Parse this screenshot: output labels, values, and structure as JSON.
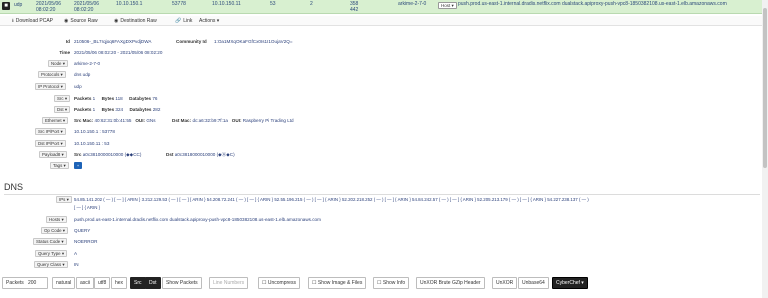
{
  "session": {
    "protocol": "udp",
    "start_time": "2021/05/06 08:02:20",
    "stop_time": "2021/05/06 08:02:20",
    "src_ip": "10.10.150.1",
    "src_port": "53778",
    "dst_ip": "10.10.150.11",
    "dst_port": "53",
    "packets": "2",
    "bytes": "358",
    "databytes": "442",
    "node": "arkime-2-7-0",
    "host_label": "Host",
    "hosts_text": "push.prod.us-east-1.internal.dradis.netflix.com   dualstack.apiproxy-push-vpc8-1850382108.us-east-1.elb.amazonaws.com"
  },
  "toolbar": {
    "download_pcap": "Download PCAP",
    "source_raw": "Source Raw",
    "destination_raw": "Destination Raw",
    "link": "Link",
    "actions": "Actions"
  },
  "details": {
    "id_label": "Id",
    "id_value": "210506-_BL7rqjoq6FAXgDXPvdjDWA",
    "community_id_label": "Community Id",
    "community_id_value": "1:Oa1MXqOKaFGfCx0Is1I1OujaV2Q=",
    "time_label": "Time",
    "time_value": "2021/05/06 08:02:20  -  2021/05/06 08:02:20",
    "node_label": "Node",
    "node_value": "arkime-2-7-0",
    "protocols_label": "Protocols",
    "protocols_value": "dns   udp",
    "ip_protocol_label": "IP Protocol",
    "ip_protocol_value": "udp",
    "src_label": "Src",
    "src_packets_label": "Packets",
    "src_packets": "1",
    "src_bytes_label": "Bytes",
    "src_bytes": "118",
    "src_databytes_label": "Databytes",
    "src_databytes": "76",
    "dst_label": "Dst",
    "dst_packets_label": "Packets",
    "dst_packets": "1",
    "dst_bytes_label": "Bytes",
    "dst_bytes": "324",
    "dst_databytes_label": "Databytes",
    "dst_databytes": "282",
    "ethernet_label": "Ethernet",
    "src_mac_label": "Src Mac:",
    "src_mac": "40:62:31:0b:41:55",
    "src_oui_label": "OUI:",
    "src_oui": "GNs",
    "dst_mac_label": "Dst Mac:",
    "dst_mac": "dc:a6:32:b9:7f:1a",
    "dst_oui_label": "OUI:",
    "dst_oui": "Raspberry Pi Trading Ltd",
    "src_ipport_label": "Src IP/Port",
    "src_ipport_value": "10.10.150.1  :  53778",
    "dst_ipport_label": "Dst IP/Port",
    "dst_ipport_value": "10.10.150.11  :  53",
    "payload8_label": "Payload8",
    "payload_src_label": "Src",
    "payload_src": "a0c3810000010000  (◆◆CC)",
    "payload_dst_label": "Dst",
    "payload_dst": "a0c3818000010000  (◆Ⓐ◆C)",
    "tags_label": "Tags",
    "tags_add": "+"
  },
  "dns": {
    "title": "DNS",
    "ips_label": "IPs",
    "ips_value": "54.85.141.202  ( — )  [ — ]  { ARIN }  3.212.129.53  ( — )  [ — ]  { ARIN }  54.208.72.241  ( — )  [ — ]  { ARIN }  52.55.196.215  ( — )  [ — ]  { ARIN }  52.202.218.252  ( — )  [ — ]  { ARIN }  54.84.242.57  ( — )  [ — ]  { ARIN }  52.205.213.179  ( — )  [ — ]  { ARIN }  54.227.238.137  ( — )",
    "ips_value_2": "[ — ]  { ARIN }",
    "hosts_label": "Hosts",
    "hosts_value": "push.prod.us-east-1.internal.dradis.netflix.com   dualstack.apiproxy-push-vpc8-1850382108.us-east-1.elb.amazonaws.com",
    "opcode_label": "Op Code",
    "opcode_value": "QUERY",
    "status_label": "Status Code",
    "status_value": "NOERROR",
    "qtype_label": "Query Type",
    "qtype_value": "A",
    "qclass_label": "Query Class",
    "qclass_value": "IN"
  },
  "bottom": {
    "packets_label": "Packets",
    "packets_value": "200",
    "natural": "natural",
    "ascii": "ascii",
    "utf8": "utf8",
    "hex": "hex",
    "src": "Src",
    "dst": "Dst",
    "show_packets": "Show Packets",
    "line_numbers": "Line Numbers",
    "uncompress": "Uncompress",
    "show_images": "Show Image & Files",
    "show_info": "Show Info",
    "unxor_brute": "UnXOR Brute GZip Header",
    "unxor": "UnXOR",
    "unbase64": "Unbase64",
    "cyberchef": "CyberChef"
  },
  "colors": {
    "session_row_bg": "#d8f0d0",
    "link_blue": "#2a3f7a",
    "tag_blue": "#1d63b7"
  }
}
